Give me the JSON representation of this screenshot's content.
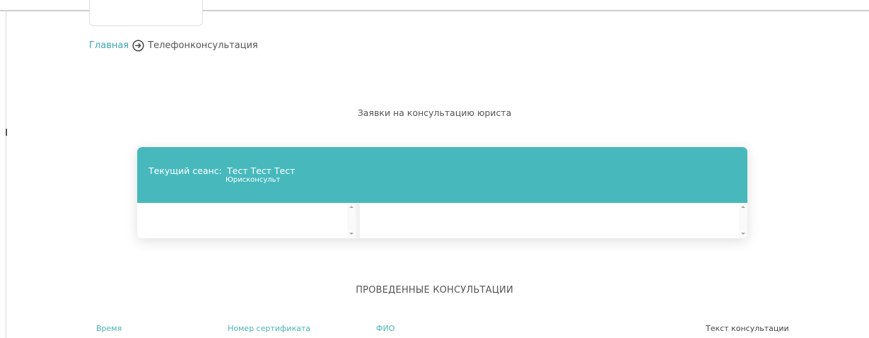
{
  "breadcrumb": {
    "home": "Главная",
    "current": "Телефонконсультация"
  },
  "requests": {
    "title": "Заявки на консультацию юриста"
  },
  "session": {
    "label": "Текущий сеанс:",
    "name": "Тест Тест Тест",
    "role": "Юрисконсульт"
  },
  "history": {
    "title": "ПРОВЕДЕННЫЕ КОНСУЛЬТАЦИИ",
    "columns": [
      "Время",
      "Номер сертификата",
      "ФИО",
      "Текст консультации"
    ]
  },
  "icons": {
    "breadcrumb_separator": "arrow-circle-right-icon"
  },
  "colors": {
    "accent": "#47b9bd",
    "link": "#3aa7b0"
  }
}
